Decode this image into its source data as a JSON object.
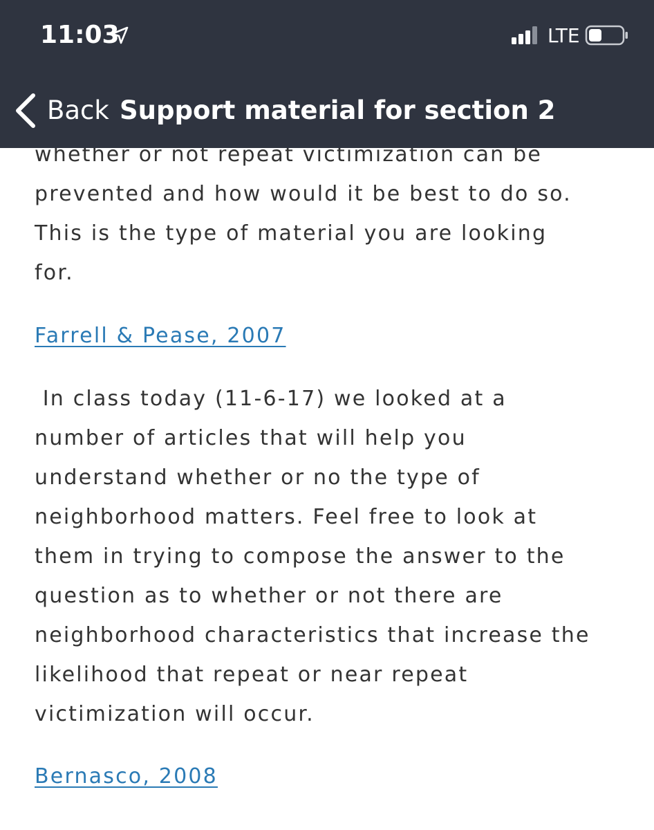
{
  "status_bar": {
    "time": "11:03",
    "carrier": "LTE"
  },
  "nav": {
    "back_label": "Back",
    "title": "Support material for section 2"
  },
  "content": {
    "intro_lines": [
      "whether or not repeat victimization can be",
      "prevented and how would it be best to do so.",
      "This is the type of material you are looking",
      "for."
    ],
    "link1": "Farrell & Pease, 2007",
    "body_lines": [
      " In class today (11-6-17) we looked at a",
      "number of articles that will help you",
      "understand whether or no the type of",
      "neighborhood matters. Feel free to look at",
      "them in trying to compose the answer to the",
      "question as to whether or not there are",
      "neighborhood characteristics that increase the",
      "likelihood that repeat or near repeat",
      "victimization will occur."
    ],
    "link2": "Bernasco, 2008"
  }
}
